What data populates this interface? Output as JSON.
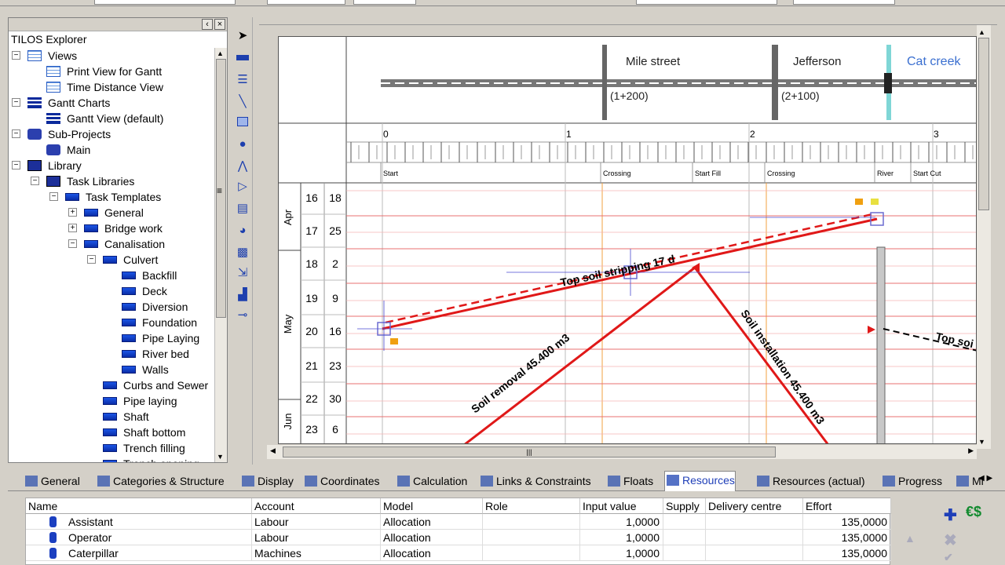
{
  "explorer": {
    "title": "TILOS Explorer",
    "tree": [
      {
        "label": "Views",
        "icon": "grid-icon",
        "level": 0,
        "exp": "−"
      },
      {
        "label": "Print View for Gantt",
        "icon": "grid-icon",
        "level": 1,
        "exp": ""
      },
      {
        "label": "Time Distance View",
        "icon": "grid-icon",
        "level": 1,
        "exp": ""
      },
      {
        "label": "Gantt Charts",
        "icon": "gantt-icon",
        "level": 0,
        "exp": "−"
      },
      {
        "label": "Gantt View (default)",
        "icon": "gantt-icon",
        "level": 1,
        "exp": ""
      },
      {
        "label": "Sub-Projects",
        "icon": "project-icon",
        "level": 0,
        "exp": "−"
      },
      {
        "label": "Main",
        "icon": "project-icon",
        "level": 1,
        "exp": ""
      },
      {
        "label": "Library",
        "icon": "library-icon",
        "level": 0,
        "exp": "−"
      },
      {
        "label": "Task Libraries",
        "icon": "library-icon",
        "level": 1,
        "exp": "−"
      },
      {
        "label": "Task Templates",
        "icon": "task-icon",
        "level": 2,
        "exp": "−"
      },
      {
        "label": "General",
        "icon": "task-icon",
        "level": 3,
        "exp": "+"
      },
      {
        "label": "Bridge work",
        "icon": "task-icon",
        "level": 3,
        "exp": "+"
      },
      {
        "label": "Canalisation",
        "icon": "task-icon",
        "level": 3,
        "exp": "−"
      },
      {
        "label": "Culvert",
        "icon": "task-icon",
        "level": 4,
        "exp": "−"
      },
      {
        "label": "Backfill",
        "icon": "task-icon",
        "level": 5,
        "exp": ""
      },
      {
        "label": "Deck",
        "icon": "task-icon",
        "level": 5,
        "exp": ""
      },
      {
        "label": "Diversion",
        "icon": "task-icon",
        "level": 5,
        "exp": ""
      },
      {
        "label": "Foundation",
        "icon": "task-icon",
        "level": 5,
        "exp": ""
      },
      {
        "label": "Pipe Laying",
        "icon": "task-icon",
        "level": 5,
        "exp": ""
      },
      {
        "label": "River bed",
        "icon": "task-icon",
        "level": 5,
        "exp": ""
      },
      {
        "label": "Walls",
        "icon": "task-icon",
        "level": 5,
        "exp": ""
      },
      {
        "label": "Curbs and Sewer",
        "icon": "task-icon",
        "level": 4,
        "exp": ""
      },
      {
        "label": "Pipe laying",
        "icon": "task-icon",
        "level": 4,
        "exp": ""
      },
      {
        "label": "Shaft",
        "icon": "task-icon",
        "level": 4,
        "exp": ""
      },
      {
        "label": "Shaft bottom",
        "icon": "task-icon",
        "level": 4,
        "exp": ""
      },
      {
        "label": "Trench filling",
        "icon": "task-icon",
        "level": 4,
        "exp": ""
      },
      {
        "label": "Trench opening",
        "icon": "task-icon",
        "level": 4,
        "exp": ""
      }
    ]
  },
  "graph": {
    "streets": [
      {
        "name": "Mile street",
        "station": "(1+200)"
      },
      {
        "name": "Jefferson",
        "station": "(2+100)"
      },
      {
        "name": "Cat creek",
        "station": ""
      }
    ],
    "km_labels": [
      "0",
      "1",
      "2",
      "3"
    ],
    "sections": [
      "Start",
      "Crossing",
      "Start Fill",
      "Crossing",
      "River",
      "Start Cut"
    ],
    "months": [
      "Apr",
      "May",
      "Jun"
    ],
    "weeks": [
      "16",
      "17",
      "18",
      "19",
      "20",
      "21",
      "22",
      "23"
    ],
    "days": [
      "18",
      "25",
      "2",
      "9",
      "16",
      "23",
      "30",
      "6"
    ],
    "tasks": [
      "Top soil stripping 17 d",
      "Soil removal 45.400 m3",
      "Soil installation 45.400 m3",
      "Top soi"
    ]
  },
  "tabs": [
    {
      "label": "General"
    },
    {
      "label": "Categories & Structure"
    },
    {
      "label": "Display"
    },
    {
      "label": "Coordinates"
    },
    {
      "label": "Calculation"
    },
    {
      "label": "Links & Constraints"
    },
    {
      "label": "Floats"
    },
    {
      "label": "Resources"
    },
    {
      "label": "Resources (actual)"
    },
    {
      "label": "Progress"
    },
    {
      "label": "Mi"
    }
  ],
  "resources": {
    "columns": [
      "Name",
      "Account",
      "Model",
      "Role",
      "Input value",
      "Supply",
      "Delivery centre",
      "Effort"
    ],
    "rows": [
      [
        "Assistant",
        "Labour",
        "Allocation",
        "",
        "1,0000",
        "",
        "",
        "135,0000"
      ],
      [
        "Operator",
        "Labour",
        "Allocation",
        "",
        "1,0000",
        "",
        "",
        "135,0000"
      ],
      [
        "Caterpillar",
        "Machines",
        "Allocation",
        "",
        "1,0000",
        "",
        "",
        "135,0000"
      ]
    ]
  },
  "colors": {
    "task": "#e01818",
    "accent": "#1f3fb8",
    "creek": "#7fd6d6"
  }
}
